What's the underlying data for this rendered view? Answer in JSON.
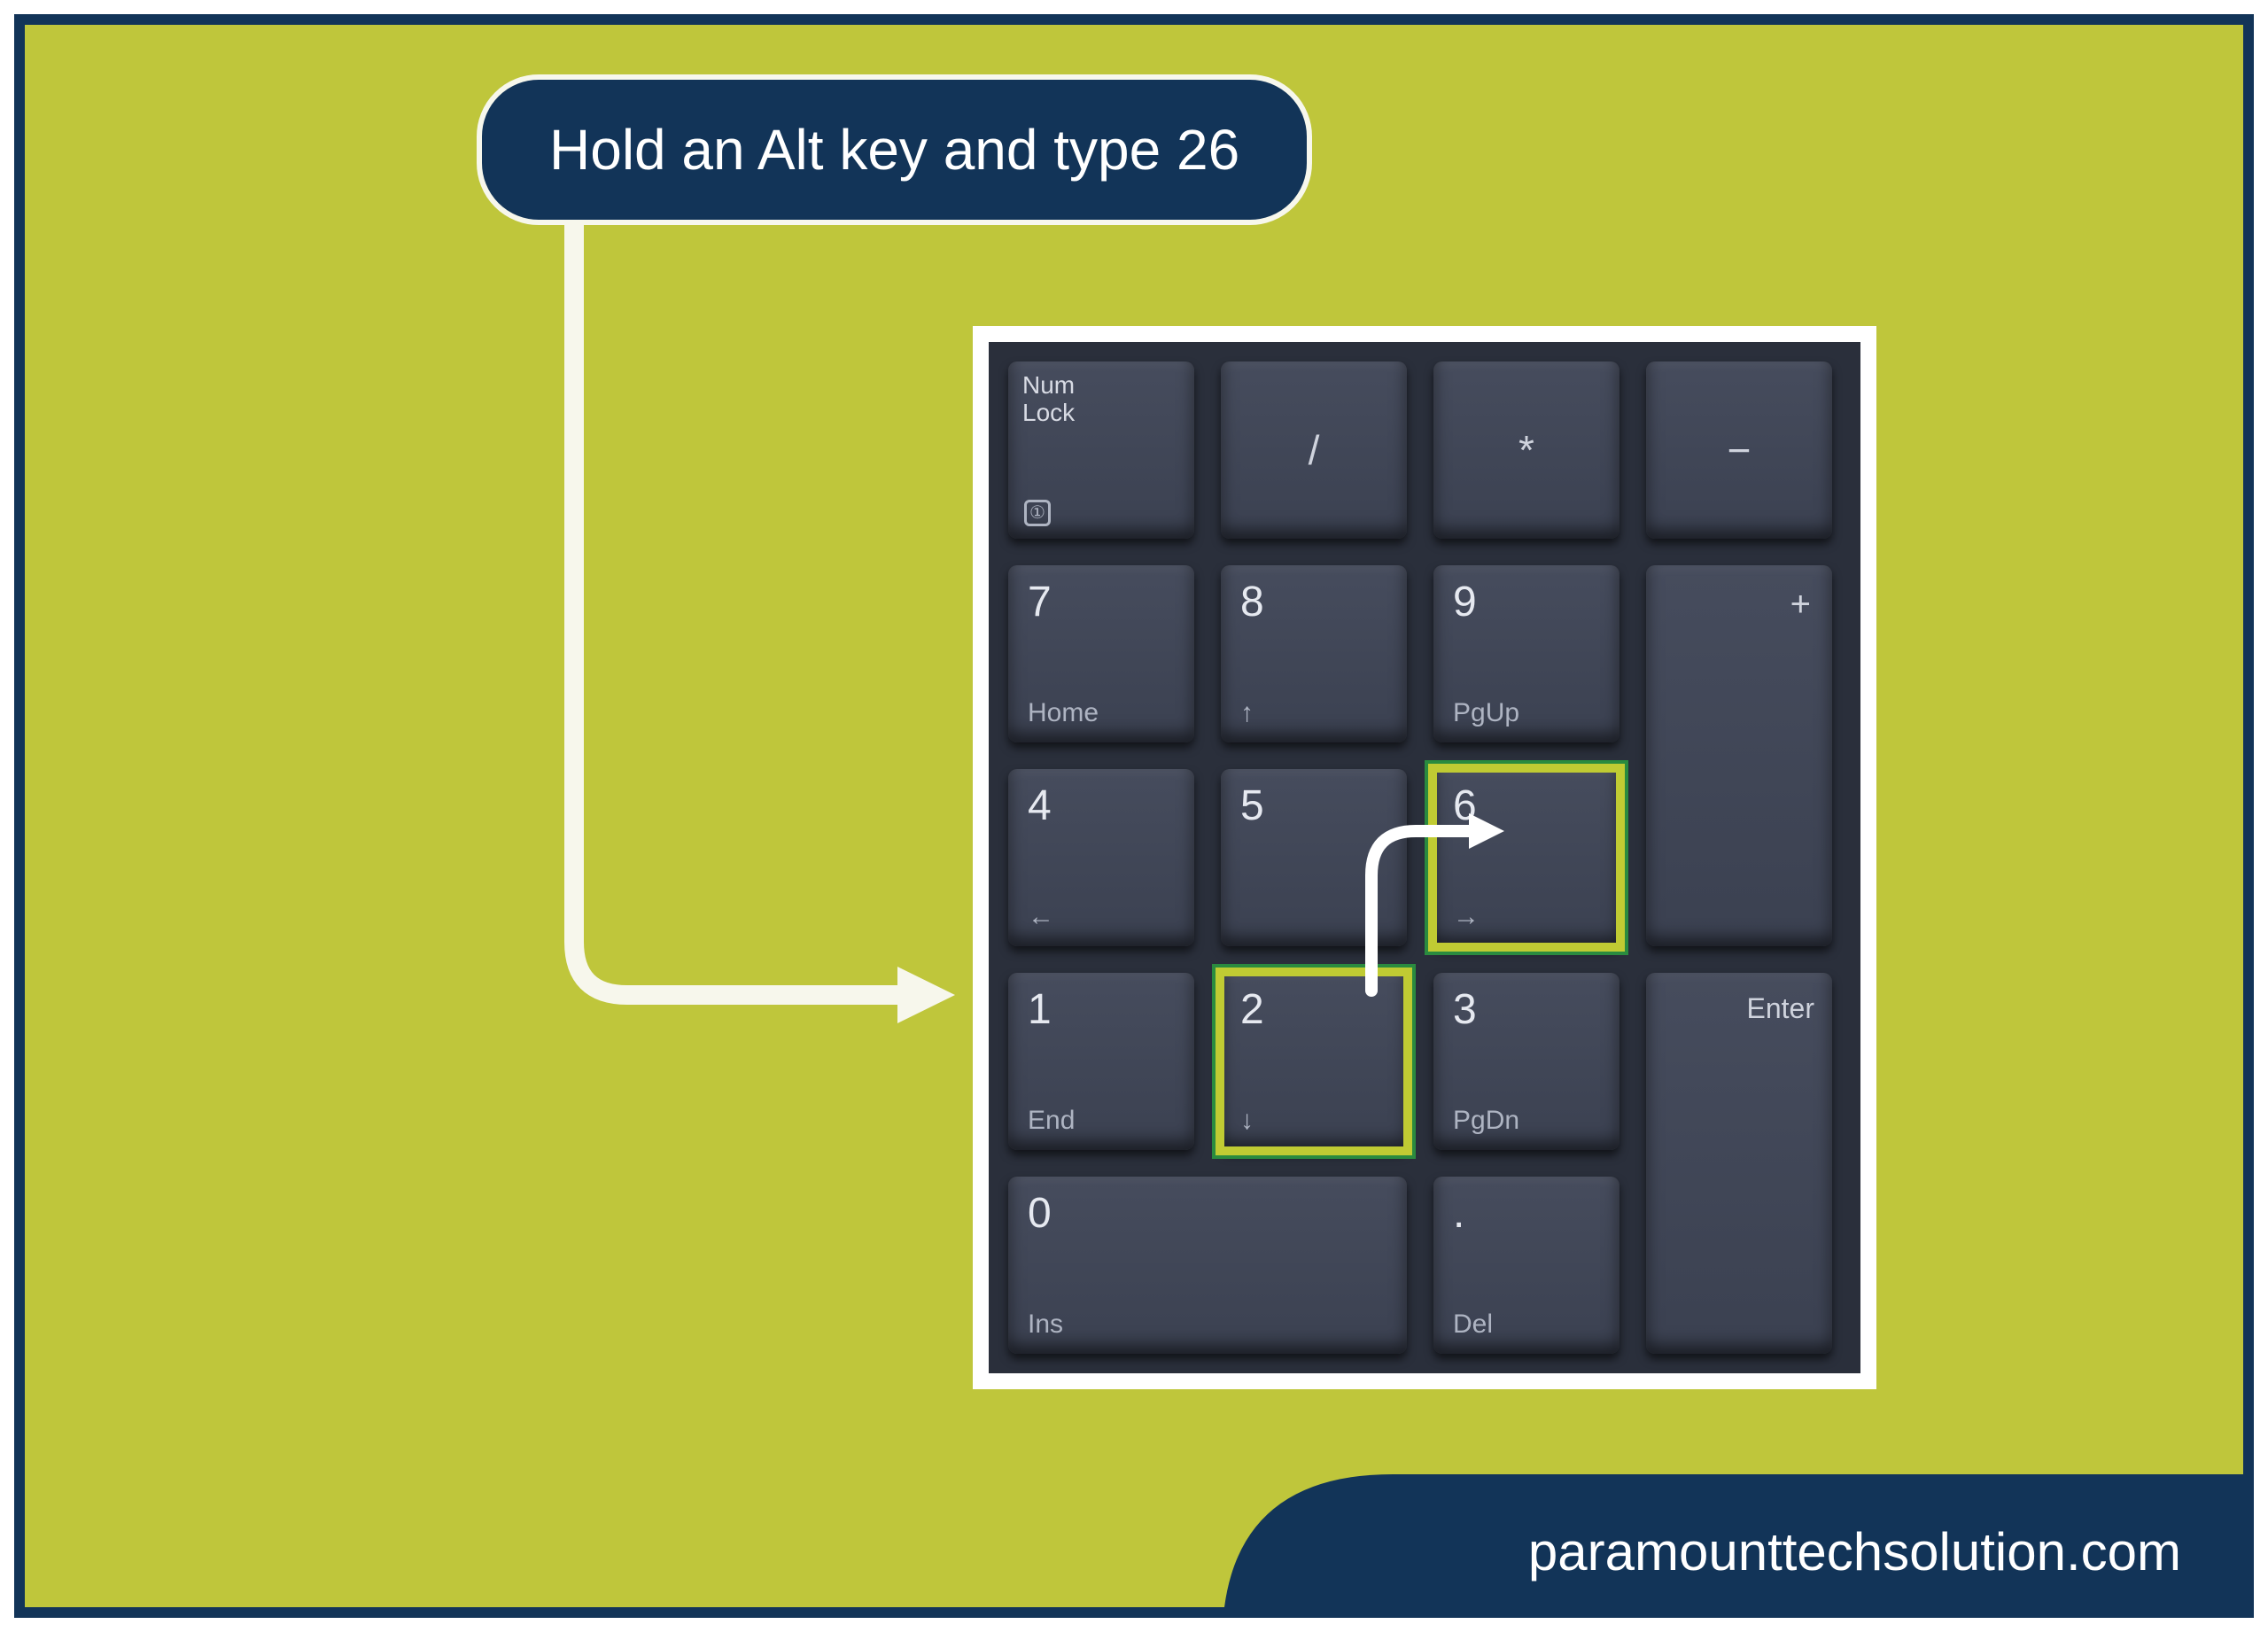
{
  "instruction": "Hold an Alt key and type 26",
  "footer": "paramounttechsolution.com",
  "highlighted_keys": [
    "2",
    "6"
  ],
  "keypad": {
    "numlock": {
      "line1": "Num",
      "line2": "Lock"
    },
    "slash": "/",
    "star": "*",
    "minus": "−",
    "plus": "+",
    "enter": "Enter",
    "k7": {
      "num": "7",
      "sub": "Home"
    },
    "k8": {
      "num": "8",
      "sub": "↑"
    },
    "k9": {
      "num": "9",
      "sub": "PgUp"
    },
    "k4": {
      "num": "4",
      "sub": "←"
    },
    "k5": {
      "num": "5",
      "sub": ""
    },
    "k6": {
      "num": "6",
      "sub": "→"
    },
    "k1": {
      "num": "1",
      "sub": "End"
    },
    "k2": {
      "num": "2",
      "sub": "↓"
    },
    "k3": {
      "num": "3",
      "sub": "PgDn"
    },
    "k0": {
      "num": "0",
      "sub": "Ins"
    },
    "kdot": {
      "num": ".",
      "sub": "Del"
    }
  }
}
